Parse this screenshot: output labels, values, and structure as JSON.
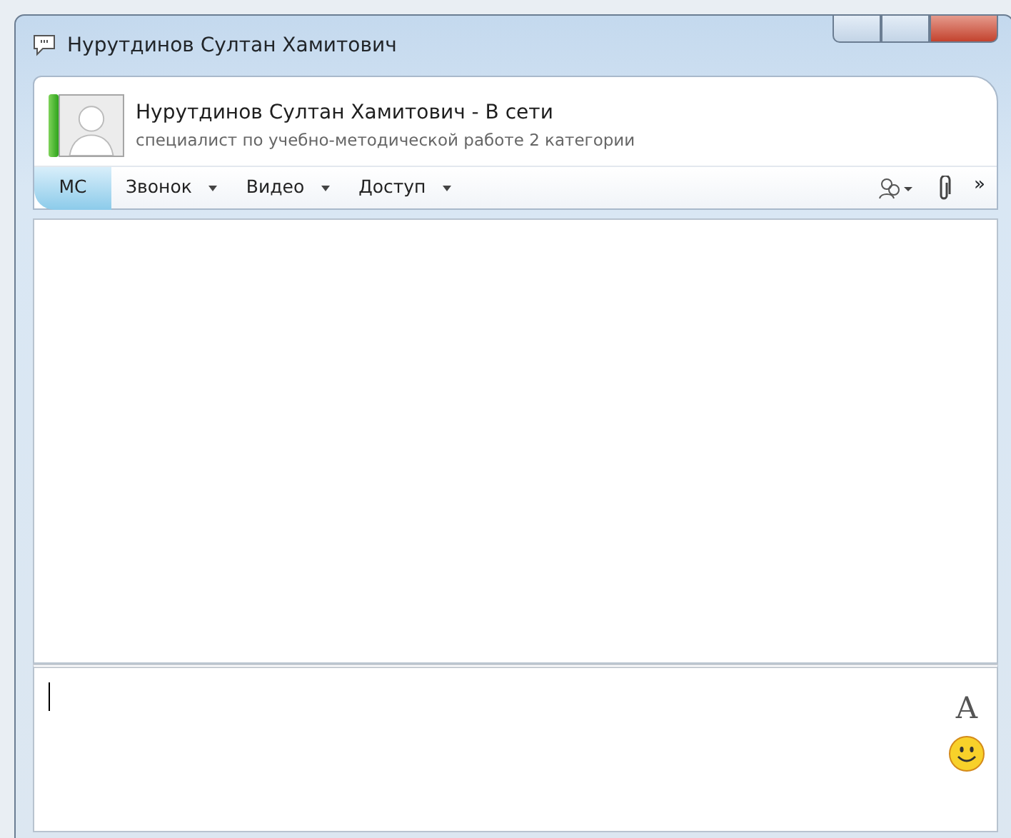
{
  "window": {
    "title": "Нурутдинов Султан Хамитович"
  },
  "contact": {
    "name": "Нурутдинов Султан Хамитович - В сети",
    "subtitle": "специалист по учебно-методической работе 2 категории",
    "online": true
  },
  "toolbar": [
    {
      "label": "МС",
      "selected": true,
      "dropdown": false
    },
    {
      "label": "Звонок",
      "selected": false,
      "dropdown": true
    },
    {
      "label": "Видео",
      "selected": false,
      "dropdown": true
    },
    {
      "label": "Доступ",
      "selected": false,
      "dropdown": true
    }
  ],
  "more": "»",
  "font_button": "A"
}
